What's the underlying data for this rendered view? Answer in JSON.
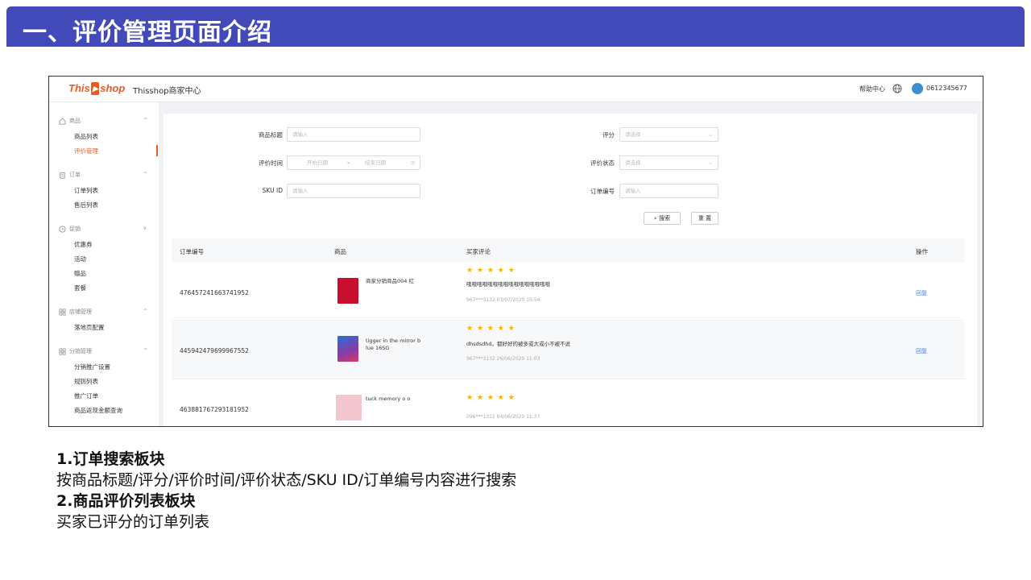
{
  "slide": {
    "title": "一、评价管理页面介绍"
  },
  "app": {
    "logo_this": "This",
    "logo_shop": "shop",
    "name": "Thisshop商家中心",
    "help": "帮助中心",
    "account": "0612345677"
  },
  "sidebar": {
    "groups": [
      {
        "label": "商品",
        "items": [
          "商品列表",
          "评价管理"
        ]
      },
      {
        "label": "订单",
        "items": [
          "订单列表",
          "售后列表"
        ]
      },
      {
        "label": "促销",
        "items": [
          "优惠券",
          "活动",
          "赠品",
          "套餐"
        ]
      },
      {
        "label": "店铺管理",
        "items": [
          "落地页配置"
        ]
      },
      {
        "label": "分销管理",
        "items": [
          "分销推广设置",
          "规则列表",
          "推广订单",
          "商品返现金额查询"
        ]
      }
    ],
    "active_item": "评价管理"
  },
  "filters": {
    "title_label": "商品标题",
    "title_placeholder": "请输入",
    "rating_label": "评分",
    "rating_placeholder": "请选择",
    "time_label": "评价时间",
    "start_placeholder": "开始日期",
    "end_placeholder": "结束日期",
    "status_label": "评价状态",
    "status_placeholder": "请选择",
    "sku_label": "SKU ID",
    "sku_placeholder": "请输入",
    "order_label": "订单编号",
    "order_placeholder": "请输入",
    "search_button": "搜索",
    "reset_button": "重 置"
  },
  "table": {
    "columns": [
      "订单编号",
      "商品",
      "买家评论",
      "操作"
    ],
    "rows": [
      {
        "order_no": "476457241663741952",
        "product": "商家分销商品004 红",
        "stars": "★ ★ ★ ★ ★",
        "comment": "哦哦哦哦哦哦哦哦哦哦哦哦哦哦哦哦",
        "meta": "967***3132 03/07/2020 15:54",
        "action": "回复",
        "img_color": "#c8102e"
      },
      {
        "order_no": "445942479699967552",
        "product": "tigger in the mirror b lue 16SG",
        "stars": "★ ★ ★ ★ ★",
        "comment": "dhsdsdhd。都好好的被多或大或小不被不说",
        "meta": "967***3132 26/06/2020 11:03",
        "action": "回复",
        "img_color": "#5a3a8c"
      },
      {
        "order_no": "463881767293181952",
        "product": "tuck memory o o",
        "stars": "★ ★ ★ ★ ★",
        "comment": "",
        "meta": "096***1312 04/06/2020 11:37",
        "action": "",
        "img_color": "#f1c6cf"
      }
    ]
  },
  "notes": {
    "h1": "1.订单搜索板块",
    "p1": "按商品标题/评分/评价时间/评价状态/SKU ID/订单编号内容进行搜索",
    "h2": "2.商品评价列表板块",
    "p2": "买家已评分的订单列表"
  },
  "colors": {
    "header": "#4249b9",
    "accent": "#ec5a24",
    "star": "#f5b400",
    "link": "#3b82f6"
  }
}
